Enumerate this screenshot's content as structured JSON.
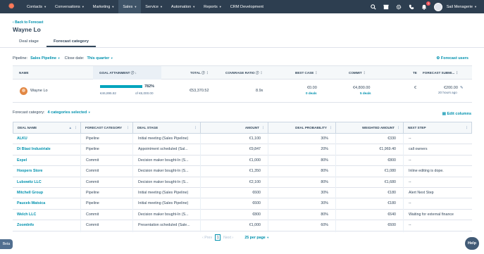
{
  "nav": {
    "items": [
      {
        "label": "Contacts"
      },
      {
        "label": "Conversations"
      },
      {
        "label": "Marketing"
      },
      {
        "label": "Sales"
      },
      {
        "label": "Service"
      },
      {
        "label": "Automation"
      },
      {
        "label": "Reports"
      },
      {
        "label": "CRM Development"
      }
    ],
    "notification_count": "1",
    "account_name": "Sail Menagerie"
  },
  "header": {
    "back_link": "Back to Forecast",
    "title": "Wayne Lo"
  },
  "tabs": [
    "Deal stage",
    "Forecast category"
  ],
  "filters": {
    "pipeline_label": "Pipeline:",
    "pipeline_value": "Sales Pipeline",
    "close_date_label": "Close date:",
    "close_date_value": "This quarter",
    "forecast_users": "Forecast users"
  },
  "summary": {
    "headers": [
      "NAME",
      "GOAL ATTAINMENT",
      "TOTAL",
      "COVERAGE RATIO",
      "BEST CASE",
      "COMMIT",
      "TE",
      "FORECAST SUBMI..."
    ],
    "row": {
      "name": "Wayne Lo",
      "attainment_pct": "782%",
      "attainment_fraction": 1.0,
      "attainment_value": "€46,895.82",
      "attainment_goal": "of €6,000.00",
      "total": "€53,370.52",
      "coverage": "8.9x",
      "best_case_value": "€0.00",
      "best_case_deals": "0 deals",
      "commit_value": "€4,800.00",
      "commit_deals": "5 deals",
      "te_value": "€",
      "submission_value": "€200.00",
      "submission_time": "20 hours ago"
    }
  },
  "forecast_category": {
    "label": "Forecast category:",
    "value": "4 categories selected",
    "edit_columns": "Edit columns"
  },
  "deals": {
    "headers": [
      "DEAL NAME",
      "FORECAST CATEGORY",
      "DEAL STAGE",
      "AMOUNT",
      "DEAL PROBABILITY",
      "WEIGHTED AMOUNT",
      "NEXT STEP"
    ],
    "rows": [
      {
        "name": "ALKU",
        "category": "Pipeline",
        "stage": "Initial meeting (Sales Pipeline)",
        "amount": "€1,100",
        "prob": "30%",
        "weighted": "€330",
        "next": "--"
      },
      {
        "name": "Di Blasi Industriale",
        "category": "Pipeline",
        "stage": "Appointment scheduled (Sal...",
        "amount": "€9,847",
        "prob": "20%",
        "weighted": "€1,969.40",
        "next": "call owners"
      },
      {
        "name": "Expel",
        "category": "Commit",
        "stage": "Decision maker bought-In (S...",
        "amount": "€1,000",
        "prob": "80%",
        "weighted": "€800",
        "next": "--"
      },
      {
        "name": "Hoopers Store",
        "category": "Commit",
        "stage": "Decision maker bought-In (S...",
        "amount": "€1,350",
        "prob": "80%",
        "weighted": "€1,080",
        "next": "Inline editing is dope."
      },
      {
        "name": "Lubowitz LLC",
        "category": "Commit",
        "stage": "Decision maker bought-In (S...",
        "amount": "€2,100",
        "prob": "80%",
        "weighted": "€1,680",
        "next": "--"
      },
      {
        "name": "Mitchell Group",
        "category": "Pipeline",
        "stage": "Initial meeting (Sales Pipeline)",
        "amount": "€600",
        "prob": "30%",
        "weighted": "€180",
        "next": "Alert Next Step"
      },
      {
        "name": "Paucek-Watsica",
        "category": "Pipeline",
        "stage": "Initial meeting (Sales Pipeline)",
        "amount": "€600",
        "prob": "30%",
        "weighted": "€180",
        "next": "--"
      },
      {
        "name": "Welch LLC",
        "category": "Commit",
        "stage": "Decision maker bought-In (S...",
        "amount": "€800",
        "prob": "80%",
        "weighted": "€640",
        "next": "Waiting for external finance"
      },
      {
        "name": "ZoomInfo",
        "category": "Commit",
        "stage": "Presentation scheduled (Sale...",
        "amount": "€1,000",
        "prob": "60%",
        "weighted": "€600",
        "next": "--"
      }
    ]
  },
  "pager": {
    "prev": "Prev",
    "page": "1",
    "next": "Next",
    "per_page": "25 per page"
  },
  "beta": "Beta",
  "help": "Help"
}
